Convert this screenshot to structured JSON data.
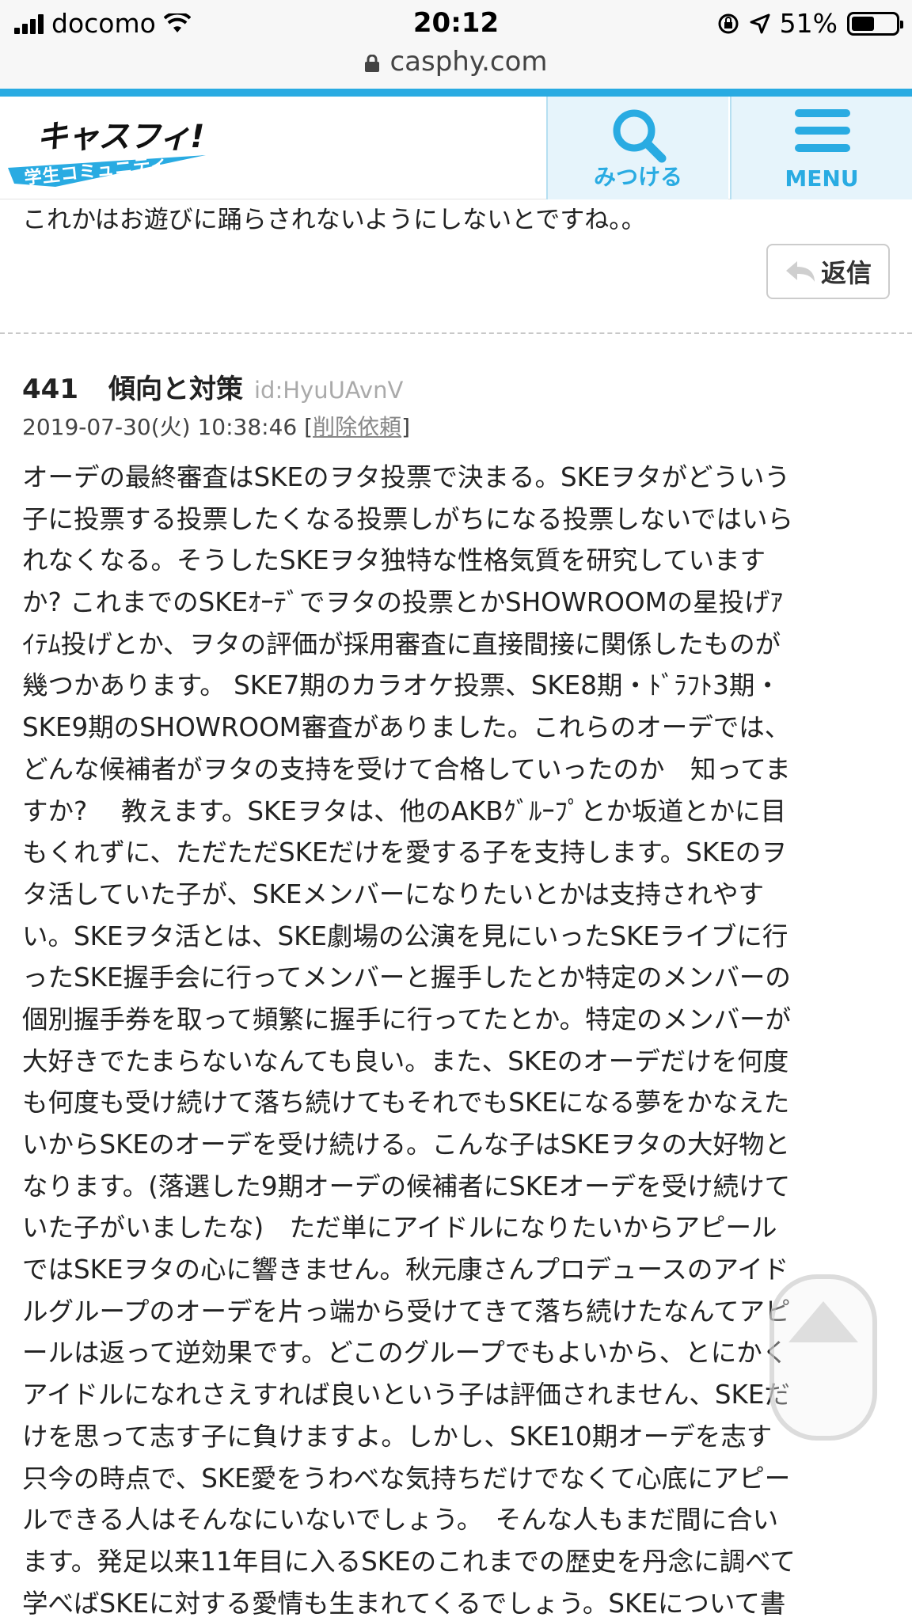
{
  "status_bar": {
    "carrier": "docomo",
    "time": "20:12",
    "battery_percent": "51%",
    "battery_level": 0.51
  },
  "browser": {
    "url": "casphy.com"
  },
  "header": {
    "logo_text": "キャスフィ!",
    "logo_tagline": "学生コミュニティ",
    "find_label": "みつける",
    "menu_label": "MENU",
    "accent_color": "#29abe2"
  },
  "previous_post": {
    "tail_text": "これかはお遊びに踊らされないようにしないとですね。。",
    "reply_label": "返信"
  },
  "post": {
    "number": "441",
    "title": "傾向と対策",
    "user_id": "id:HyuUAvnV",
    "timestamp": "2019-07-30(火) 10:38:46",
    "delete_request": "削除依頼",
    "body_lines": [
      "オーデの最終審査はSKEのヲタ投票で決まる。SKEヲタがどういう",
      "子に投票する投票したくなる投票しがちになる投票しないではいら",
      "れなくなる。そうしたSKEヲタ独特な性格気質を研究しています",
      "か? これまでのSKEｵｰﾃﾞでヲタの投票とかSHOWROOMの星投げｱ",
      "ｲﾃﾑ投げとか、ヲタの評価が採用審査に直接間接に関係したものが",
      "幾つかあります。 SKE7期のカラオケ投票、SKE8期・ﾄﾞﾗﾌﾄ3期・",
      "SKE9期のSHOWROOM審査がありました。これらのオーデでは、",
      "どんな候補者がヲタの支持を受けて合格していったのか　知ってま",
      "すか?　 教えます。SKEヲタは、他のAKBｸﾞﾙｰﾌﾟとか坂道とかに目",
      "もくれずに、ただただSKEだけを愛する子を支持します。SKEのヲ",
      "タ活していた子が、SKEメンバーになりたいとかは支持されやす",
      "い。SKEヲタ活とは、SKE劇場の公演を見にいったSKEライブに行",
      "ったSKE握手会に行ってメンバーと握手したとか特定のメンバーの",
      "個別握手券を取って頻繁に握手に行ってたとか。特定のメンバーが",
      "大好きでたまらないなんても良い。また、SKEのオーデだけを何度",
      "も何度も受け続けて落ち続けてもそれでもSKEになる夢をかなえた",
      "いからSKEのオーデを受け続ける。こんな子はSKEヲタの大好物と",
      "なります。(落選した9期オーデの候補者にSKEオーデを受け続けて",
      "いた子がいましたな)　ただ単にアイドルになりたいからアピール",
      "ではSKEヲタの心に響きません。秋元康さんプロデュースのアイド",
      "ルグループのオーデを片っ端から受けてきて落ち続けたなんてアピ",
      "ールは返って逆効果です。どこのグループでもよいから、とにかく",
      "アイドルになれさえすれば良いという子は評価されません、SKEだ",
      "けを思って志す子に負けますよ。しかし、SKE10期オーデを志す",
      "只今の時点で、SKE愛をうわべな気持ちだけでなくて心底にアピー",
      "ルできる人はそんなにいないでしょう。　そんな人もまだ間に合い",
      "ます。発足以来11年目に入るSKEのこれまでの歴史を丹念に調べて",
      "学べばSKEに対する愛情も生まれてくるでしょう。SKEについて書"
    ]
  }
}
